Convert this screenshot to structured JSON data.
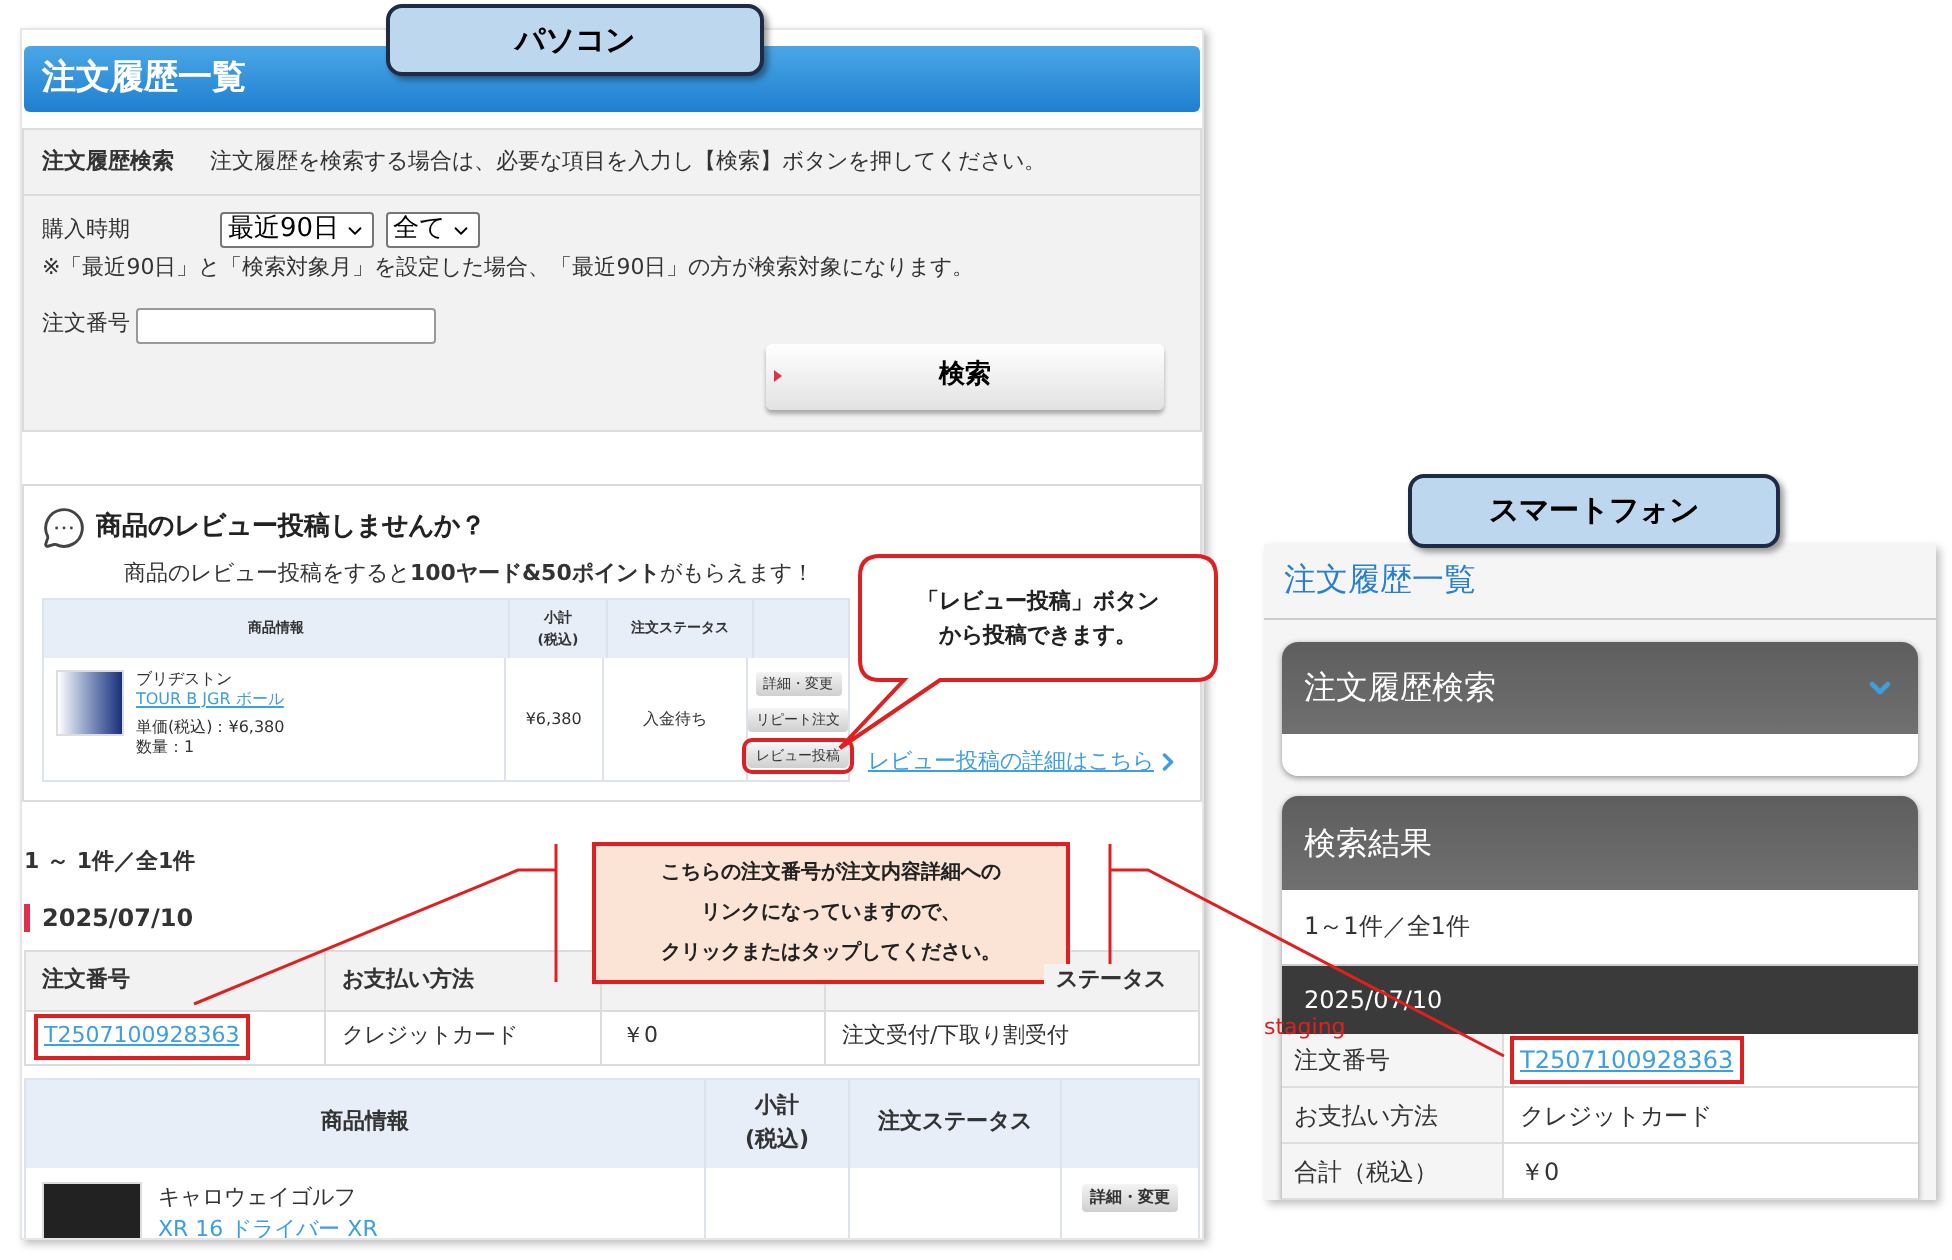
{
  "pc_label": "パソコン",
  "smartphone_label": "スマートフォン",
  "pc": {
    "title": "注文履歴一覧",
    "search": {
      "heading": "注文履歴検索",
      "description": "注文履歴を検索する場合は、必要な項目を入力し【検索】ボタンを押してください。",
      "period_label": "購入時期",
      "period": "最近90日",
      "month": "全て",
      "note": "※「最近90日」と「検索対象月」を設定した場合、「最近90日」の方が検索対象になります。",
      "order_number_label": "注文番号",
      "button": "検索"
    },
    "review": {
      "heading": "商品のレビュー投稿しませんか？",
      "lead": "商品のレビュー投稿をすると**100ヤード&50ポイント**がもらえます！",
      "columns": [
        "商品情報",
        "小計\n(税込)",
        "注文ステータス"
      ],
      "item": {
        "brand": "ブリヂストン",
        "name": "TOUR B JGR ボール",
        "unit_price": "単価(税込)：¥6,380",
        "quantity": "数量：1",
        "subtotal": "¥6,380",
        "status": "入金待ち",
        "buttons": [
          {
            "label": "詳細・変更",
            "highlighted": false
          },
          {
            "label": "リピート注文",
            "highlighted": false
          },
          {
            "label": "レビュー投稿",
            "highlighted": true
          }
        ]
      },
      "details_link": "レビュー投稿の詳細はこちら"
    },
    "results": {
      "count": "1 ～ 1件／全1件",
      "date": "2025/07/10",
      "order_columns": [
        "注文番号",
        "お支払い方法"
      ],
      "order_status_column": "ステータス",
      "order": {
        "number": "T2507100928363",
        "payment": "クレジットカード",
        "total": "￥0",
        "status": "注文受付/下取り割受付"
      },
      "product_columns": [
        "商品情報",
        "小計\n(税込)",
        "注文ステータス"
      ],
      "product": {
        "brand": "キャロウェイゴルフ",
        "name": "XR 16 ドライバー XR",
        "button": "詳細・変更"
      }
    }
  },
  "review_callout": [
    "「レビュー投稿」ボタン",
    "から投稿できます。"
  ],
  "link_callout": [
    "こちらの注文番号が注文内容詳細への",
    "リンクになっていますので、",
    "クリックまたはタップしてください。"
  ],
  "smartphone": {
    "title": "注文履歴一覧",
    "search_heading": "注文履歴検索",
    "search_expanded": false,
    "results_heading": "検索結果",
    "count": "1～1件／全1件",
    "date": "2025/07/10",
    "environment_tag": "staging",
    "rows": [
      {
        "label": "注文番号",
        "value": "T2507100928363",
        "kind": "link"
      },
      {
        "label": "お支払い方法",
        "value": "クレジットカード",
        "kind": "text"
      },
      {
        "label": "合計（税込）",
        "value": "￥0",
        "kind": "text"
      }
    ]
  }
}
